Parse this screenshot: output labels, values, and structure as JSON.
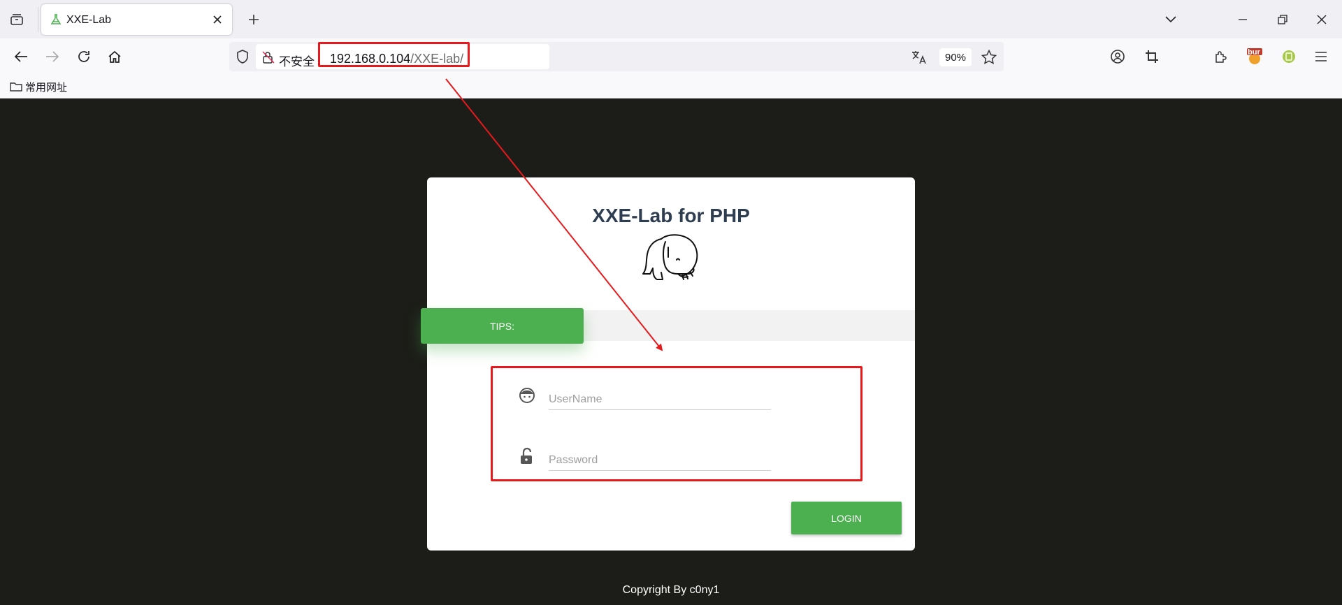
{
  "tab": {
    "title": "XXE-Lab"
  },
  "url": {
    "insecure_label": "不安全",
    "host": "192.168.0.104",
    "path": "/XXE-lab/",
    "zoom": "90%"
  },
  "extension": {
    "badge": "bur"
  },
  "bookmarks": {
    "folder": "常用网址"
  },
  "page": {
    "title": "XXE-Lab for PHP",
    "tips_label": "TIPS:",
    "username_placeholder": "UserName",
    "password_placeholder": "Password",
    "login_label": "LOGIN",
    "footer": "Copyright By c0ny1"
  },
  "colors": {
    "accent": "#4caf50",
    "annotation": "#e8191c",
    "page_bg": "#1c1d18"
  }
}
